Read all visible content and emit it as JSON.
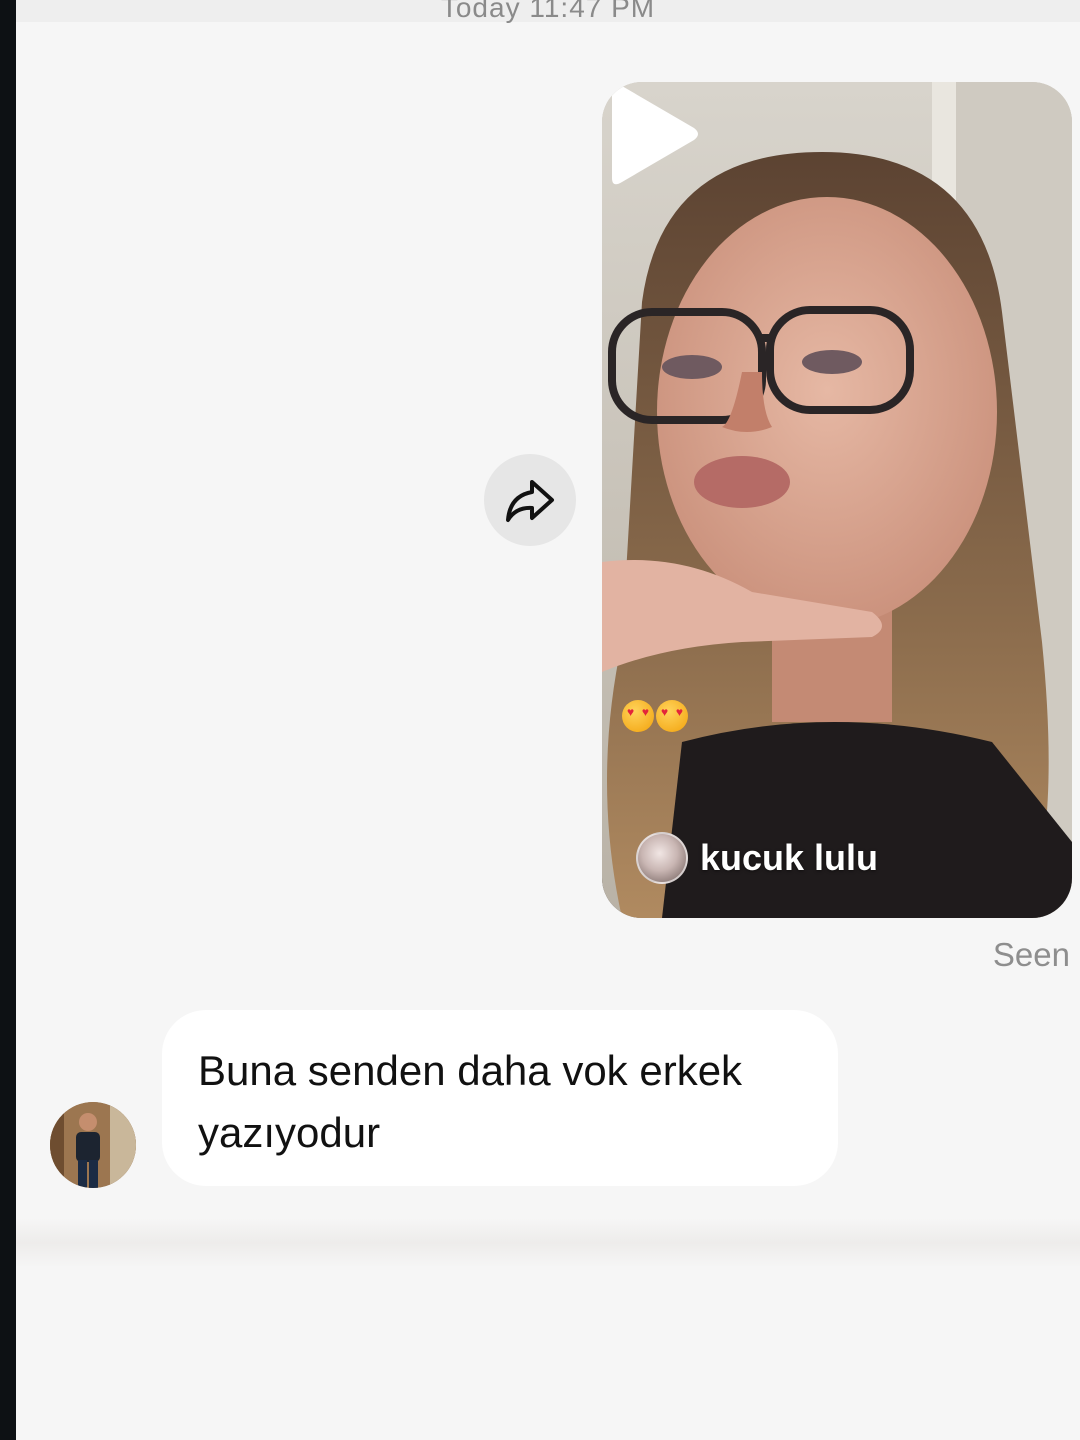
{
  "thread": {
    "timestamp": "Today 11:47 PM"
  },
  "shared_video": {
    "author_name": "kucuk lulu",
    "caption_emoji": [
      "heart-eyes-emoji",
      "heart-eyes-emoji"
    ],
    "play_icon": "play-icon"
  },
  "share_action": {
    "icon": "share-arrow-icon"
  },
  "status": {
    "seen_label": "Seen"
  },
  "incoming_message": {
    "text_line1": "Buna senden daha vok erkek",
    "text_line2": "yazıyodur"
  },
  "colors": {
    "background": "#f6f6f6",
    "bubble": "#ffffff",
    "share_button": "#e6e6e6",
    "seen_text": "#8e8e8e"
  }
}
